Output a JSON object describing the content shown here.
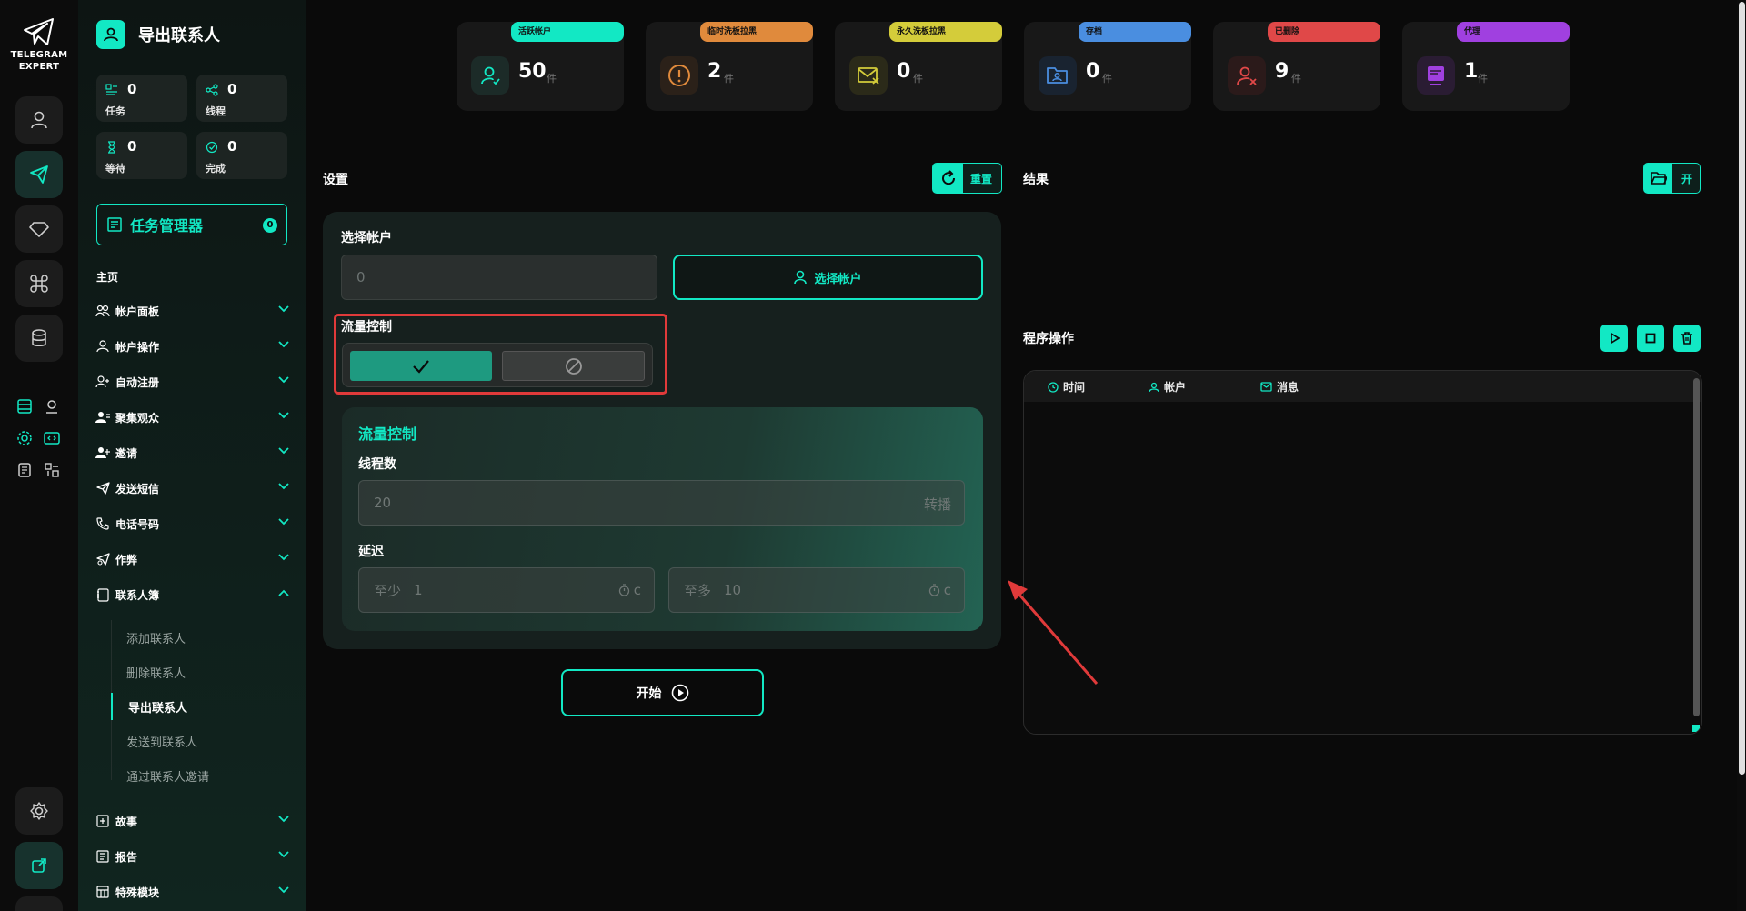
{
  "brand": {
    "line1": "TELEGRAM",
    "line2": "EXPERT"
  },
  "sidebar": {
    "title": "导出联系人",
    "stats": [
      {
        "value": "0",
        "label": "任务",
        "icon": "tasks-icon"
      },
      {
        "value": "0",
        "label": "线程",
        "icon": "threads-icon"
      },
      {
        "value": "0",
        "label": "等待",
        "icon": "hourglass-icon"
      },
      {
        "value": "0",
        "label": "完成",
        "icon": "check-circle-icon"
      }
    ],
    "task_manager": {
      "label": "任务管理器",
      "badge": "0"
    },
    "section": "主页",
    "nav": [
      {
        "label": "帐户面板",
        "icon": "users-icon"
      },
      {
        "label": "帐户操作",
        "icon": "user-icon"
      },
      {
        "label": "自动注册",
        "icon": "user-plus-icon"
      },
      {
        "label": "聚集观众",
        "icon": "audience-icon"
      },
      {
        "label": "邀请",
        "icon": "invite-icon"
      },
      {
        "label": "发送短信",
        "icon": "send-icon"
      },
      {
        "label": "电话号码",
        "icon": "phone-icon"
      },
      {
        "label": "作弊",
        "icon": "cheat-icon"
      },
      {
        "label": "联系人簿",
        "icon": "contacts-book-icon"
      }
    ],
    "sub_items": [
      "添加联系人",
      "删除联系人",
      "导出联系人",
      "发送到联系人",
      "通过联系人邀请"
    ],
    "nav_bottom": [
      {
        "label": "故事",
        "icon": "story-icon"
      },
      {
        "label": "报告",
        "icon": "report-icon"
      },
      {
        "label": "特殊模块",
        "icon": "modules-icon"
      }
    ]
  },
  "top_stats": [
    {
      "tag": "活跃帐户",
      "value": "50",
      "unit": "件",
      "tag_color": "#12e8c4",
      "icon_color": "#12e8c4"
    },
    {
      "tag": "临时洗板拉黑",
      "value": "2",
      "unit": "件",
      "tag_color": "#e08a3c",
      "icon_color": "#e08a3c"
    },
    {
      "tag": "永久洗板拉黑",
      "value": "0",
      "unit": "件",
      "tag_color": "#d4cc3a",
      "icon_color": "#d4cc3a"
    },
    {
      "tag": "存档",
      "value": "0",
      "unit": "件",
      "tag_color": "#4a8ee0",
      "icon_color": "#4a8ee0"
    },
    {
      "tag": "已删除",
      "value": "9",
      "unit": "件",
      "tag_color": "#e04848",
      "icon_color": "#e04848"
    },
    {
      "tag": "代理",
      "value": "1",
      "unit": "件",
      "tag_color": "#a040e0",
      "icon_color": "#a040e0"
    }
  ],
  "settings": {
    "title": "设置",
    "reset_label": "重置",
    "select_account_label": "选择帐户",
    "account_value": "0",
    "select_account_button": "选择帐户",
    "flow_control_label": "流量控制",
    "flow_control_enabled": true,
    "inner_title": "流量控制",
    "threads_label": "线程数",
    "threads_value": "20",
    "threads_suffix": "转播",
    "delay_label": "延迟",
    "delay_min_prefix": "至少",
    "delay_min": "1",
    "delay_max_prefix": "至多",
    "delay_max": "10",
    "delay_unit": "c",
    "start_label": "开始"
  },
  "results": {
    "title": "结果",
    "open_label": "开",
    "ops_title": "程序操作",
    "columns": [
      {
        "label": "时间",
        "icon": "clock-icon"
      },
      {
        "label": "帐户",
        "icon": "user-icon"
      },
      {
        "label": "消息",
        "icon": "mail-icon"
      }
    ]
  },
  "accent": "#12e8c4"
}
